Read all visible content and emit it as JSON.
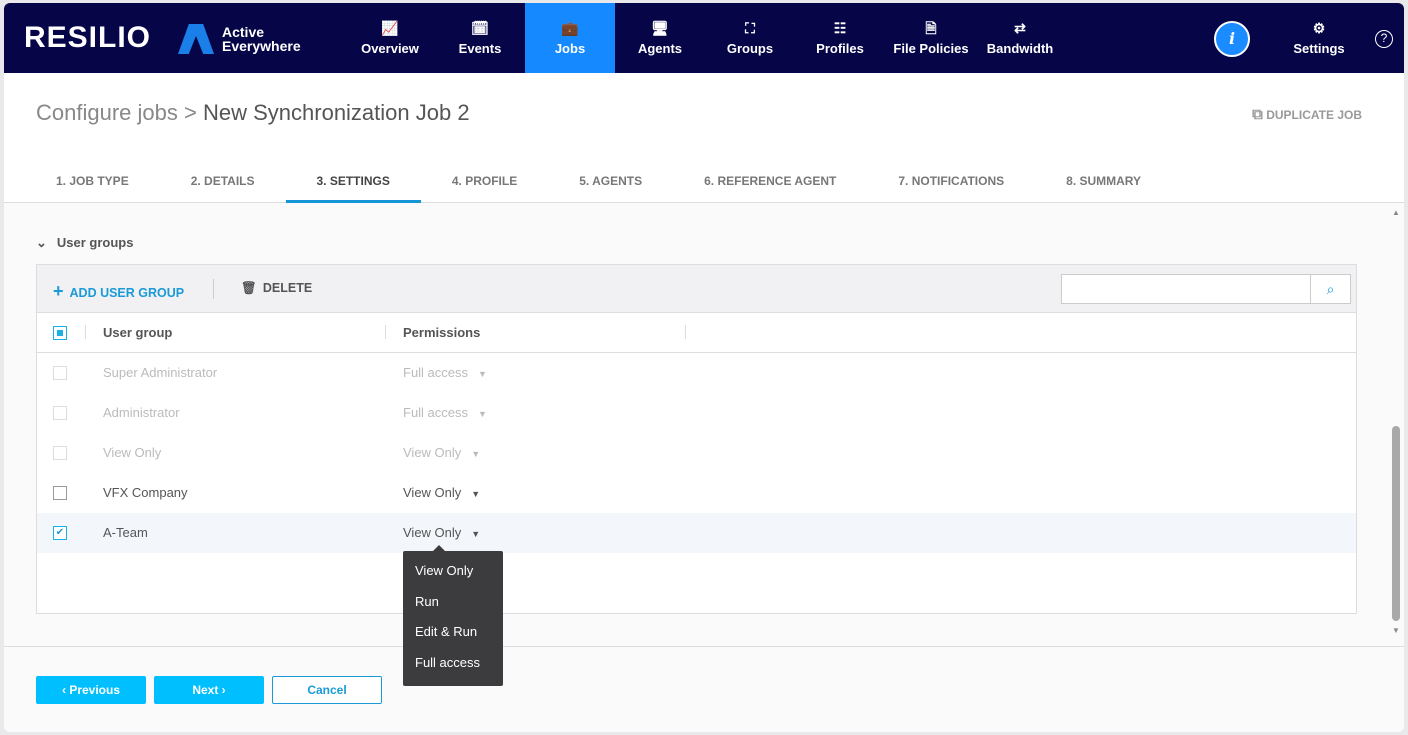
{
  "nav": {
    "logo": "RESILIO",
    "brand_line1": "Active",
    "brand_line2": "Everywhere",
    "items": [
      {
        "label": "Overview",
        "icon": "📈"
      },
      {
        "label": "Events",
        "icon": "🗓"
      },
      {
        "label": "Jobs",
        "icon": "💼"
      },
      {
        "label": "Agents",
        "icon": "🖥"
      },
      {
        "label": "Groups",
        "icon": "⛶"
      },
      {
        "label": "Profiles",
        "icon": "☷"
      },
      {
        "label": "File Policies",
        "icon": "🗎"
      },
      {
        "label": "Bandwidth",
        "icon": "⇄"
      }
    ],
    "info_icon": "i",
    "settings": "Settings",
    "settings_icon": "⚙",
    "help_icon": "?"
  },
  "breadcrumb": {
    "parent": "Configure jobs",
    "sep": ">",
    "current": "New Synchronization Job 2"
  },
  "duplicate": "DUPLICATE JOB",
  "duplicate_icon": "⧉",
  "tabs": [
    "1. JOB TYPE",
    "2. DETAILS",
    "3. SETTINGS",
    "4. PROFILE",
    "5. AGENTS",
    "6. REFERENCE AGENT",
    "7. NOTIFICATIONS",
    "8. SUMMARY"
  ],
  "section": {
    "chevron": "⌄",
    "title": "User groups"
  },
  "toolbar": {
    "add_icon": "+",
    "add": "ADD USER GROUP",
    "delete_icon": "🗑",
    "delete": "DELETE",
    "search_placeholder": "",
    "search_icon": "⌕"
  },
  "table": {
    "headers": [
      "User group",
      "Permissions"
    ],
    "rows": [
      {
        "name": "Super Administrator",
        "perm": "Full access"
      },
      {
        "name": "Administrator",
        "perm": "Full access"
      },
      {
        "name": "View Only",
        "perm": "View Only"
      },
      {
        "name": "VFX Company",
        "perm": "View Only"
      },
      {
        "name": "A-Team",
        "perm": "View Only",
        "check": "✔"
      }
    ]
  },
  "dropdown": [
    "View Only",
    "Run",
    "Edit & Run",
    "Full access"
  ],
  "caret": "▼",
  "footer": {
    "previous": "‹ Previous",
    "next": "Next ›",
    "cancel": "Cancel"
  }
}
